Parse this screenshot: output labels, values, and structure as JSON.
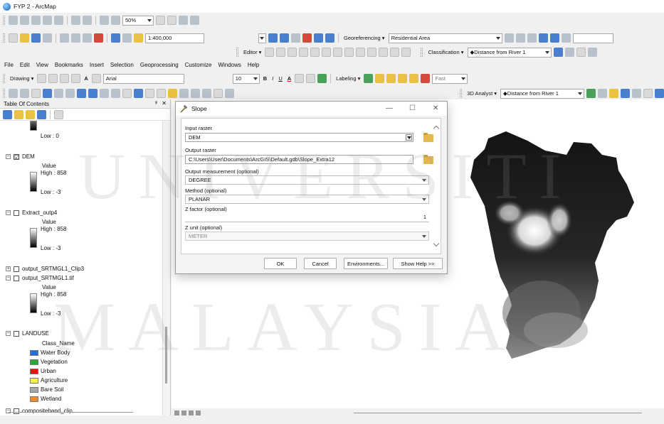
{
  "window": {
    "title": "FYP 2 - ArcMap"
  },
  "toolbar1": {
    "zoom_value": "50%"
  },
  "toolbar2": {
    "scale_value": "1:400,000",
    "georeferencing_label": "Georeferencing",
    "georef_layer": "Residential Area"
  },
  "toolbar3": {
    "editor_label": "Editor",
    "classification_label": "Classification",
    "classification_layer": "Distance from River 1"
  },
  "menus": [
    "File",
    "Edit",
    "View",
    "Bookmarks",
    "Insert",
    "Selection",
    "Geoprocessing",
    "Customize",
    "Windows",
    "Help"
  ],
  "drawing_toolbar": {
    "drawing_label": "Drawing",
    "font_name": "Arial",
    "font_size": "10",
    "bold": "B",
    "italic": "I",
    "underline": "U",
    "text_a": "A",
    "labeling_label": "Labeling",
    "label_mode": "Fast"
  },
  "toolbar5": {
    "analyst_label": "3D Analyst",
    "analyst_layer": "Distance from River 1"
  },
  "toc": {
    "title": "Table Of Contents",
    "pin": "ᅢ",
    "close": "✕",
    "top_low": "Low : 0",
    "layers": [
      {
        "name": "DEM",
        "checked": "☑",
        "value_label": "Value",
        "high": "High : 858",
        "low": "Low : -3"
      },
      {
        "name": "Extract_outp4",
        "value_label": "Value",
        "high": "High : 858",
        "low": "Low : -3"
      },
      {
        "name": "output_SRTMGL1_Clip3"
      },
      {
        "name": "output_SRTMGL1.tif",
        "value_label": "Value",
        "high": "High : 858",
        "low": "Low : -3"
      },
      {
        "name": "LANDUSE",
        "class_label": "Class_Name"
      }
    ],
    "landuse_classes": [
      {
        "name": "Water Body",
        "color": "#1f6fe0"
      },
      {
        "name": "Vegetation",
        "color": "#2aa53a"
      },
      {
        "name": "Urban",
        "color": "#e01414"
      },
      {
        "name": "Agriculture",
        "color": "#ffef4a"
      },
      {
        "name": "Bare Soil",
        "color": "#a8a8a8"
      },
      {
        "name": "Wetland",
        "color": "#f08a2a"
      }
    ],
    "last_layer_partial": "compositeband_clip"
  },
  "dialog": {
    "title": "Slope",
    "input_raster_label": "Input raster",
    "input_raster_value": "DEM",
    "output_raster_label": "Output raster",
    "output_raster_value": "C:\\Users\\User\\Documents\\ArcGIS\\Default.gdb\\Slope_Extra12",
    "measurement_label": "Output measurement (optional)",
    "measurement_value": "DEGREE",
    "method_label": "Method (optional)",
    "method_value": "PLANAR",
    "zfactor_label": "Z factor (optional)",
    "zfactor_value": "1",
    "zunit_label": "Z unit (optional)",
    "zunit_value": "METER",
    "ok_label": "OK",
    "cancel_label": "Cancel",
    "env_label": "Environments...",
    "help_label": "Show Help >>",
    "minimize": "—",
    "maximize": "☐",
    "close": "✕"
  },
  "watermark": {
    "line1": "UNIVERSITI",
    "line2": "MALAYSIA"
  }
}
